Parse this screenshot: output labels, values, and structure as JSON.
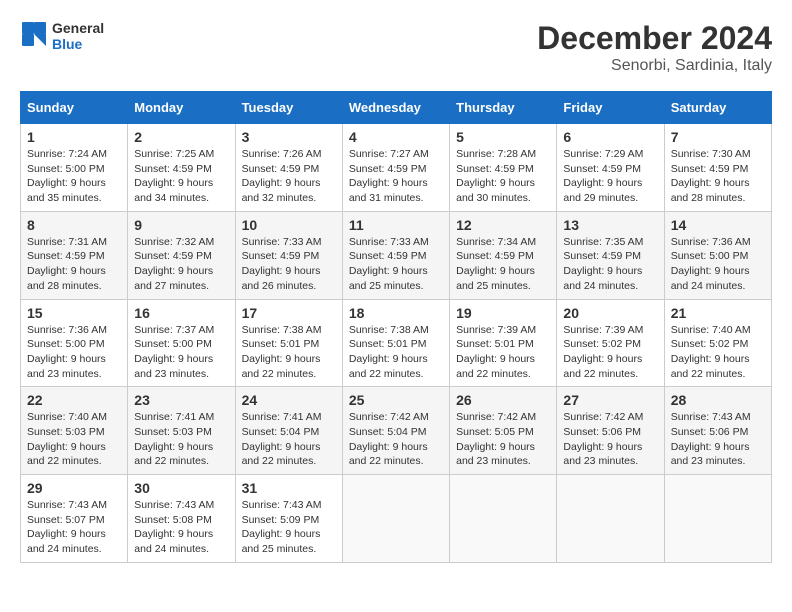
{
  "header": {
    "logo_line1": "General",
    "logo_line2": "Blue",
    "month": "December 2024",
    "location": "Senorbi, Sardinia, Italy"
  },
  "weekdays": [
    "Sunday",
    "Monday",
    "Tuesday",
    "Wednesday",
    "Thursday",
    "Friday",
    "Saturday"
  ],
  "weeks": [
    [
      {
        "day": "1",
        "info": "Sunrise: 7:24 AM\nSunset: 5:00 PM\nDaylight: 9 hours and 35 minutes."
      },
      {
        "day": "2",
        "info": "Sunrise: 7:25 AM\nSunset: 4:59 PM\nDaylight: 9 hours and 34 minutes."
      },
      {
        "day": "3",
        "info": "Sunrise: 7:26 AM\nSunset: 4:59 PM\nDaylight: 9 hours and 32 minutes."
      },
      {
        "day": "4",
        "info": "Sunrise: 7:27 AM\nSunset: 4:59 PM\nDaylight: 9 hours and 31 minutes."
      },
      {
        "day": "5",
        "info": "Sunrise: 7:28 AM\nSunset: 4:59 PM\nDaylight: 9 hours and 30 minutes."
      },
      {
        "day": "6",
        "info": "Sunrise: 7:29 AM\nSunset: 4:59 PM\nDaylight: 9 hours and 29 minutes."
      },
      {
        "day": "7",
        "info": "Sunrise: 7:30 AM\nSunset: 4:59 PM\nDaylight: 9 hours and 28 minutes."
      }
    ],
    [
      {
        "day": "8",
        "info": "Sunrise: 7:31 AM\nSunset: 4:59 PM\nDaylight: 9 hours and 28 minutes."
      },
      {
        "day": "9",
        "info": "Sunrise: 7:32 AM\nSunset: 4:59 PM\nDaylight: 9 hours and 27 minutes."
      },
      {
        "day": "10",
        "info": "Sunrise: 7:33 AM\nSunset: 4:59 PM\nDaylight: 9 hours and 26 minutes."
      },
      {
        "day": "11",
        "info": "Sunrise: 7:33 AM\nSunset: 4:59 PM\nDaylight: 9 hours and 25 minutes."
      },
      {
        "day": "12",
        "info": "Sunrise: 7:34 AM\nSunset: 4:59 PM\nDaylight: 9 hours and 25 minutes."
      },
      {
        "day": "13",
        "info": "Sunrise: 7:35 AM\nSunset: 4:59 PM\nDaylight: 9 hours and 24 minutes."
      },
      {
        "day": "14",
        "info": "Sunrise: 7:36 AM\nSunset: 5:00 PM\nDaylight: 9 hours and 24 minutes."
      }
    ],
    [
      {
        "day": "15",
        "info": "Sunrise: 7:36 AM\nSunset: 5:00 PM\nDaylight: 9 hours and 23 minutes."
      },
      {
        "day": "16",
        "info": "Sunrise: 7:37 AM\nSunset: 5:00 PM\nDaylight: 9 hours and 23 minutes."
      },
      {
        "day": "17",
        "info": "Sunrise: 7:38 AM\nSunset: 5:01 PM\nDaylight: 9 hours and 22 minutes."
      },
      {
        "day": "18",
        "info": "Sunrise: 7:38 AM\nSunset: 5:01 PM\nDaylight: 9 hours and 22 minutes."
      },
      {
        "day": "19",
        "info": "Sunrise: 7:39 AM\nSunset: 5:01 PM\nDaylight: 9 hours and 22 minutes."
      },
      {
        "day": "20",
        "info": "Sunrise: 7:39 AM\nSunset: 5:02 PM\nDaylight: 9 hours and 22 minutes."
      },
      {
        "day": "21",
        "info": "Sunrise: 7:40 AM\nSunset: 5:02 PM\nDaylight: 9 hours and 22 minutes."
      }
    ],
    [
      {
        "day": "22",
        "info": "Sunrise: 7:40 AM\nSunset: 5:03 PM\nDaylight: 9 hours and 22 minutes."
      },
      {
        "day": "23",
        "info": "Sunrise: 7:41 AM\nSunset: 5:03 PM\nDaylight: 9 hours and 22 minutes."
      },
      {
        "day": "24",
        "info": "Sunrise: 7:41 AM\nSunset: 5:04 PM\nDaylight: 9 hours and 22 minutes."
      },
      {
        "day": "25",
        "info": "Sunrise: 7:42 AM\nSunset: 5:04 PM\nDaylight: 9 hours and 22 minutes."
      },
      {
        "day": "26",
        "info": "Sunrise: 7:42 AM\nSunset: 5:05 PM\nDaylight: 9 hours and 23 minutes."
      },
      {
        "day": "27",
        "info": "Sunrise: 7:42 AM\nSunset: 5:06 PM\nDaylight: 9 hours and 23 minutes."
      },
      {
        "day": "28",
        "info": "Sunrise: 7:43 AM\nSunset: 5:06 PM\nDaylight: 9 hours and 23 minutes."
      }
    ],
    [
      {
        "day": "29",
        "info": "Sunrise: 7:43 AM\nSunset: 5:07 PM\nDaylight: 9 hours and 24 minutes."
      },
      {
        "day": "30",
        "info": "Sunrise: 7:43 AM\nSunset: 5:08 PM\nDaylight: 9 hours and 24 minutes."
      },
      {
        "day": "31",
        "info": "Sunrise: 7:43 AM\nSunset: 5:09 PM\nDaylight: 9 hours and 25 minutes."
      },
      {
        "day": "",
        "info": ""
      },
      {
        "day": "",
        "info": ""
      },
      {
        "day": "",
        "info": ""
      },
      {
        "day": "",
        "info": ""
      }
    ]
  ]
}
